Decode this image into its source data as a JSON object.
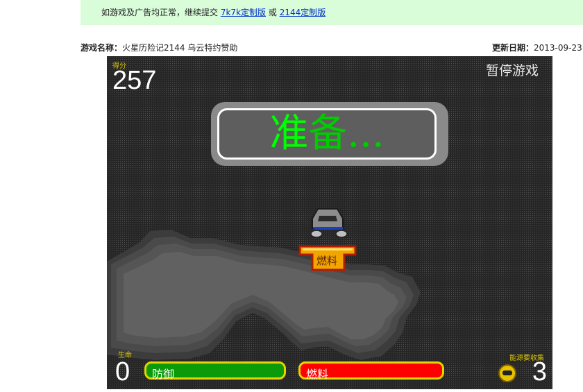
{
  "notice": {
    "text": "如游戏及广告均正常，继续提交",
    "link1": "7k7k定制版",
    "or": "或",
    "link2": "2144定制版"
  },
  "info": {
    "name_label": "游戏名称：",
    "name_value": "火星历险记2144 乌云特约赞助",
    "date_label": "更新日期：",
    "date_value": "2013-09-23"
  },
  "game": {
    "score_label": "得分",
    "score": "257",
    "pause": "暂停游戏",
    "ready_highlight": "准",
    "ready_rest": "备...",
    "fuel_pickup": "燃料",
    "lives_label": "生命",
    "lives": "0",
    "defense_label": "防御",
    "fuel_label": "燃料",
    "fuel_level": 1.0,
    "defense_level": 1.0,
    "collect_label": "能源要收集",
    "collect_count": "3"
  }
}
